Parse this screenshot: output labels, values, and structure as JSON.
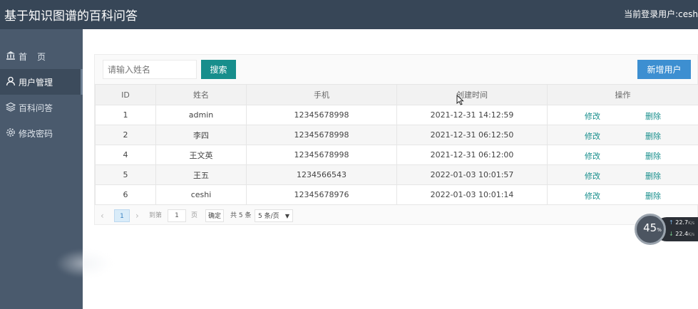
{
  "header": {
    "app_title": "基于知识图谱的百科问答",
    "current_user": "当前登录用户:cesh"
  },
  "sidebar": {
    "items": [
      {
        "label": "首页",
        "icon": "bank-icon",
        "active": false
      },
      {
        "label": "用户管理",
        "icon": "user-icon",
        "active": true
      },
      {
        "label": "百科问答",
        "icon": "layers-icon",
        "active": false
      },
      {
        "label": "修改密码",
        "icon": "gear-icon",
        "active": false
      }
    ]
  },
  "toolbar": {
    "search_placeholder": "请输入姓名",
    "search_label": "搜索",
    "add_label": "新增用户"
  },
  "table": {
    "columns": [
      "ID",
      "姓名",
      "手机",
      "创建时间",
      "操作"
    ],
    "rows": [
      {
        "id": "1",
        "name": "admin",
        "phone": "12345678998",
        "created": "2021-12-31 14:12:59"
      },
      {
        "id": "2",
        "name": "李四",
        "phone": "12345678998",
        "created": "2021-12-31 06:12:50"
      },
      {
        "id": "4",
        "name": "王文英",
        "phone": "12345678998",
        "created": "2021-12-31 06:12:00"
      },
      {
        "id": "5",
        "name": "王五",
        "phone": "1234566543",
        "created": "2022-01-03 10:01:57"
      },
      {
        "id": "6",
        "name": "ceshi",
        "phone": "12345678976",
        "created": "2022-01-03 10:01:14"
      }
    ],
    "edit_label": "修改",
    "delete_label": "删除"
  },
  "pagination": {
    "current_page": "1",
    "goto_label": "到第",
    "goto_value": "1",
    "page_unit": "页",
    "confirm_label": "确定",
    "total": "共 5 条",
    "page_size": "5 条/页"
  },
  "net_widget": {
    "percent": "45",
    "percent_unit": "%",
    "upload": "22.7",
    "download": "22.4",
    "rate_unit": "K/s"
  },
  "colors": {
    "header_bg": "#374657",
    "sidebar_bg": "#4a5a6d",
    "primary_teal": "#178e8c",
    "add_blue": "#3d8fd1"
  }
}
